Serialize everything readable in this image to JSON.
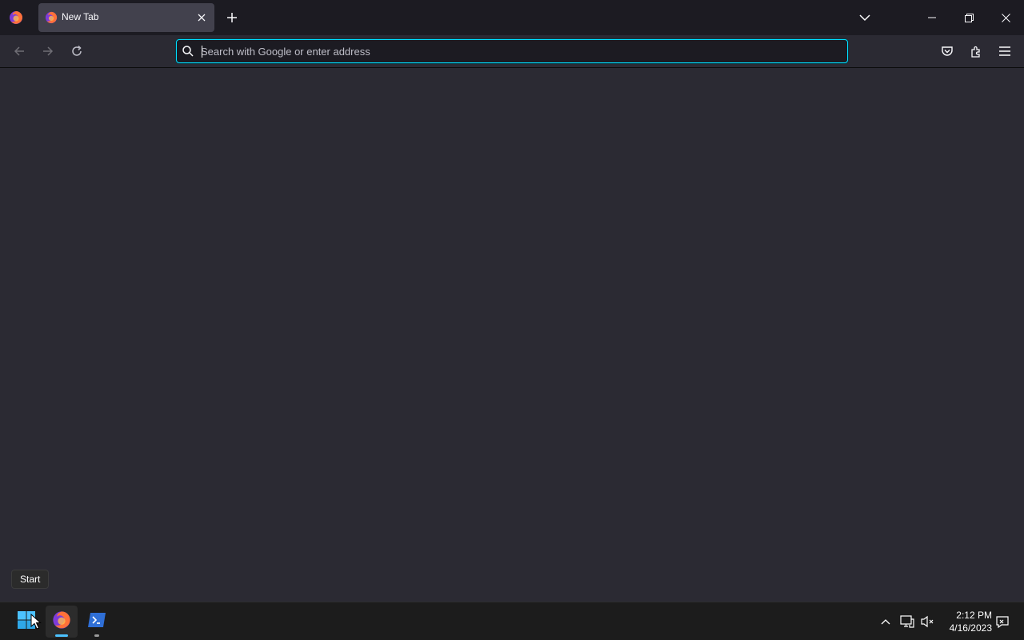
{
  "browser": {
    "tab": {
      "title": "New Tab",
      "favicon": "firefox-icon",
      "active": true
    },
    "urlbar": {
      "placeholder": "Search with Google or enter address",
      "value": ""
    },
    "accent_color": "#00ddff"
  },
  "tooltip": {
    "text": "Start"
  },
  "taskbar": {
    "apps": [
      {
        "name": "Start",
        "icon": "windows-start-icon"
      },
      {
        "name": "Firefox",
        "icon": "firefox-icon",
        "state": "active"
      },
      {
        "name": "Terminal",
        "icon": "terminal-icon",
        "state": "open"
      }
    ],
    "clock": {
      "time": "2:12 PM",
      "date": "4/16/2023"
    }
  }
}
